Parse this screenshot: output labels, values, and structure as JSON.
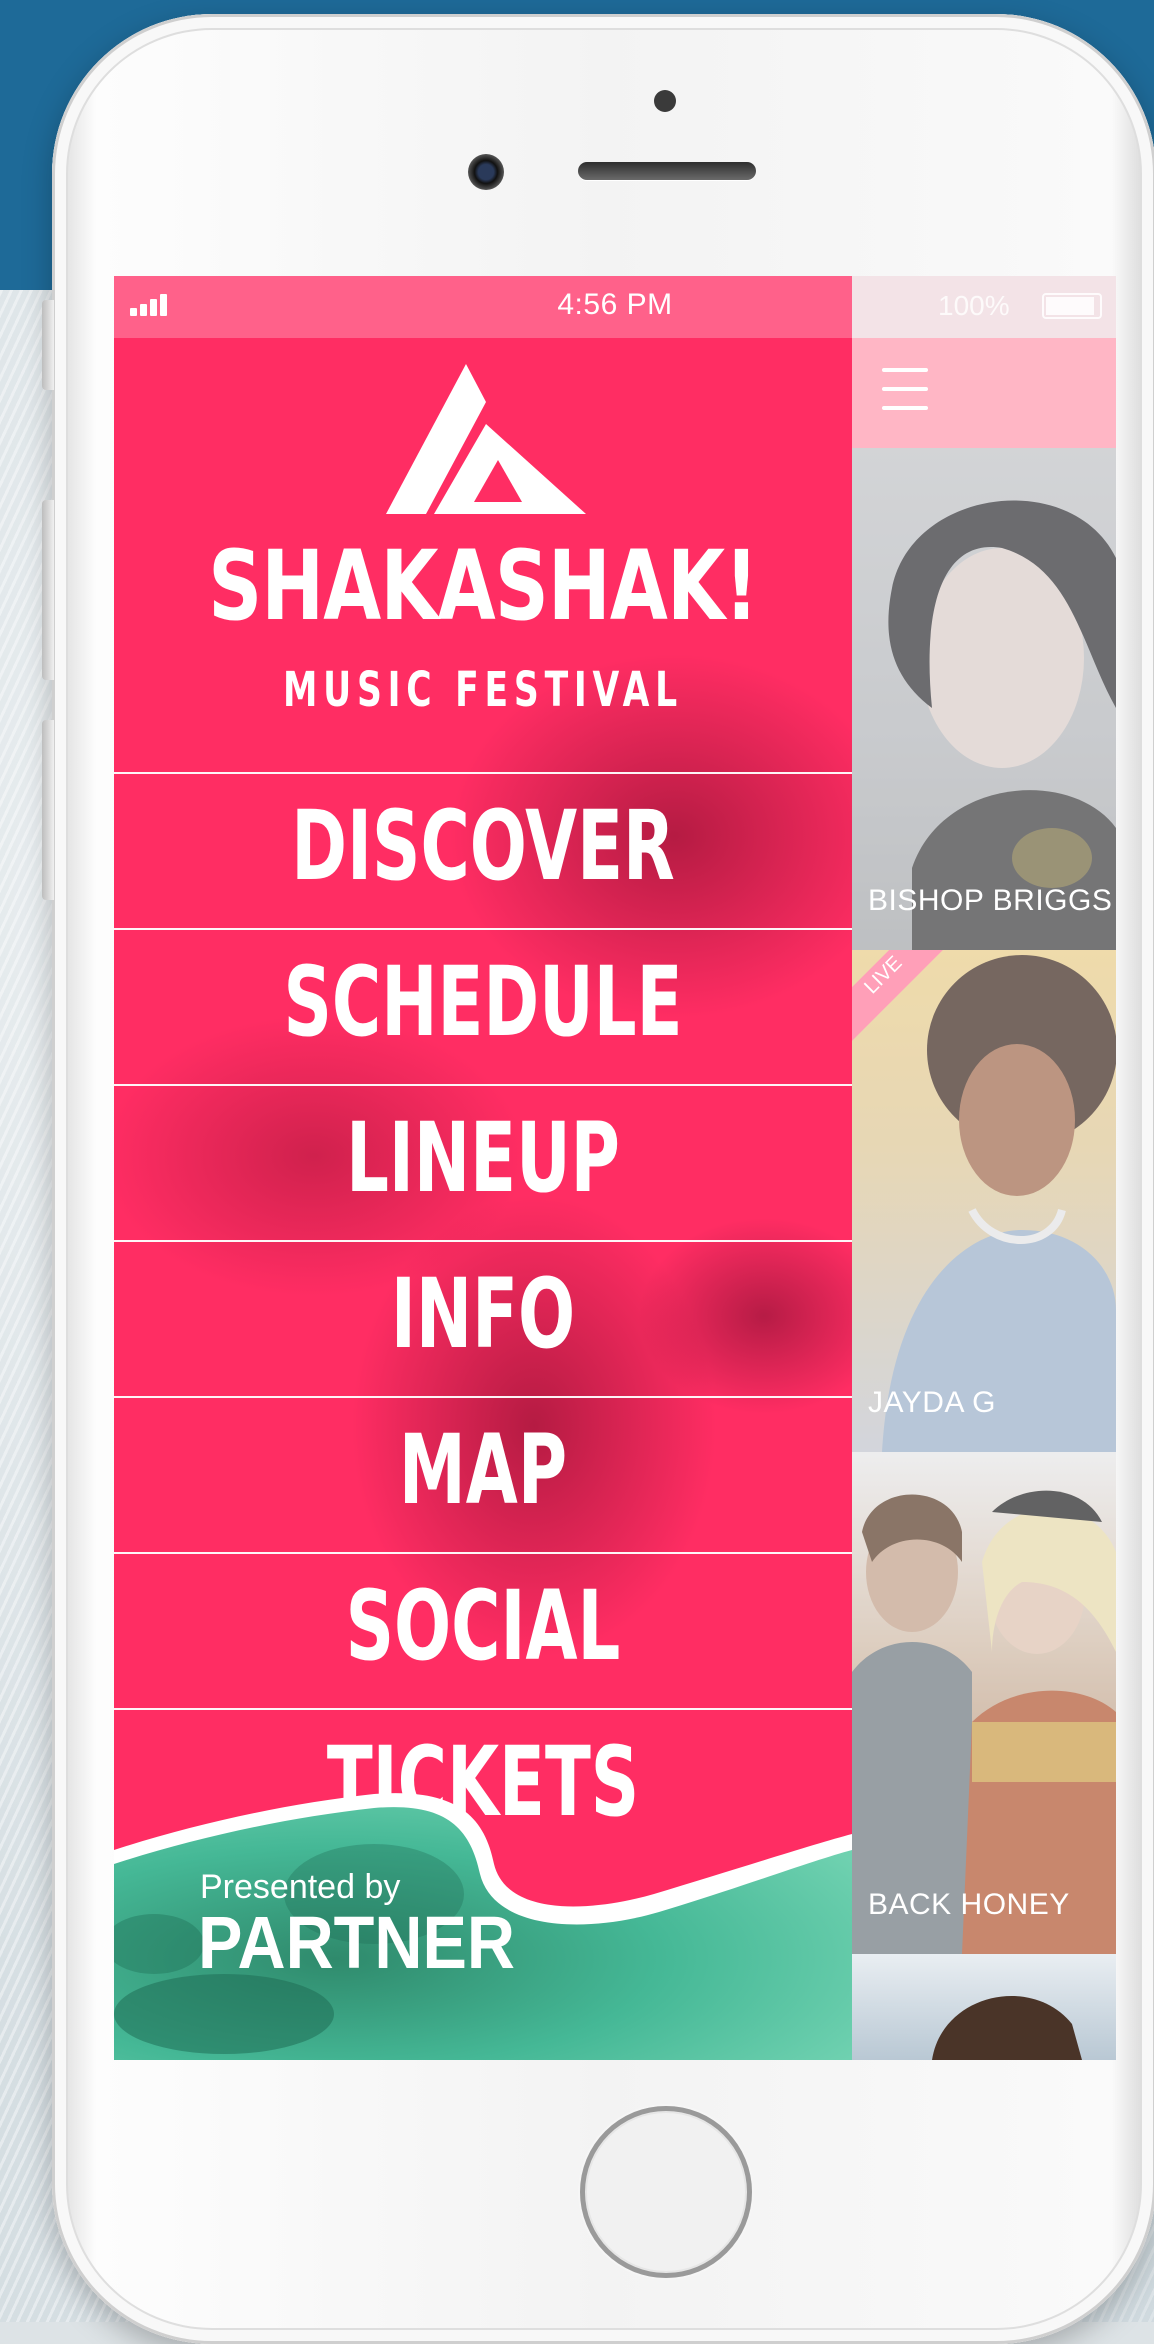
{
  "status_bar": {
    "time": "4:56 PM",
    "battery": "100%"
  },
  "menu": {
    "brand_title": "SHAKASHAK!",
    "brand_subtitle": "MUSIC FESTIVAL",
    "items": [
      {
        "label": "DISCOVER"
      },
      {
        "label": "SCHEDULE"
      },
      {
        "label": "LINEUP"
      },
      {
        "label": "INFO"
      },
      {
        "label": "MAP"
      },
      {
        "label": "SOCIAL"
      },
      {
        "label": "TICKETS"
      }
    ],
    "sponsor_prefix": "Presented by",
    "sponsor_name": "PARTNER"
  },
  "lineup_preview": {
    "cards": [
      {
        "name": "BISHOP BRIGGS"
      },
      {
        "name": "JAYDA G",
        "badge": "LIVE"
      },
      {
        "name": "BACK HONEY"
      }
    ]
  },
  "colors": {
    "menu_accent": "#ff2d63",
    "sponsor_green": "#3fae8c",
    "navbar_pink": "#ffb6c5",
    "backdrop_blue": "#1e6a98"
  },
  "icons": [
    "signal-icon",
    "battery-icon",
    "hamburger-icon",
    "festival-logo-icon",
    "home-button"
  ]
}
